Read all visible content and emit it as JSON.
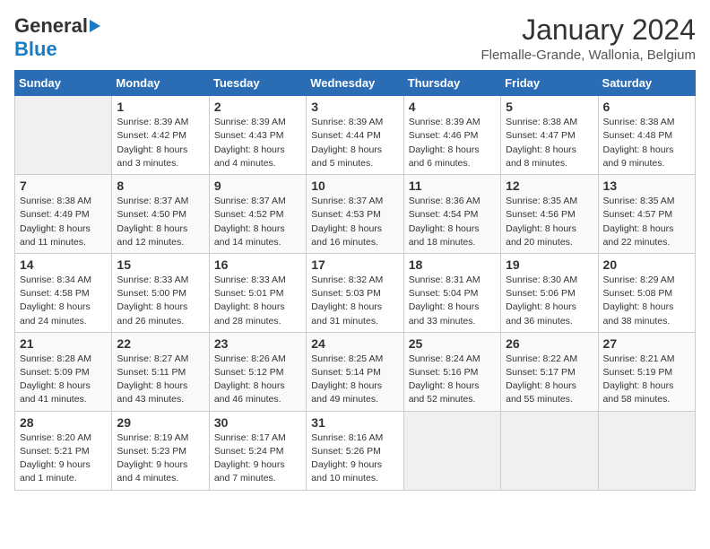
{
  "header": {
    "logo_general": "General",
    "logo_blue": "Blue",
    "month_title": "January 2024",
    "location": "Flemalle-Grande, Wallonia, Belgium"
  },
  "days_of_week": [
    "Sunday",
    "Monday",
    "Tuesday",
    "Wednesday",
    "Thursday",
    "Friday",
    "Saturday"
  ],
  "weeks": [
    [
      {
        "day": "",
        "sunrise": "",
        "sunset": "",
        "daylight": ""
      },
      {
        "day": "1",
        "sunrise": "Sunrise: 8:39 AM",
        "sunset": "Sunset: 4:42 PM",
        "daylight": "Daylight: 8 hours and 3 minutes."
      },
      {
        "day": "2",
        "sunrise": "Sunrise: 8:39 AM",
        "sunset": "Sunset: 4:43 PM",
        "daylight": "Daylight: 8 hours and 4 minutes."
      },
      {
        "day": "3",
        "sunrise": "Sunrise: 8:39 AM",
        "sunset": "Sunset: 4:44 PM",
        "daylight": "Daylight: 8 hours and 5 minutes."
      },
      {
        "day": "4",
        "sunrise": "Sunrise: 8:39 AM",
        "sunset": "Sunset: 4:46 PM",
        "daylight": "Daylight: 8 hours and 6 minutes."
      },
      {
        "day": "5",
        "sunrise": "Sunrise: 8:38 AM",
        "sunset": "Sunset: 4:47 PM",
        "daylight": "Daylight: 8 hours and 8 minutes."
      },
      {
        "day": "6",
        "sunrise": "Sunrise: 8:38 AM",
        "sunset": "Sunset: 4:48 PM",
        "daylight": "Daylight: 8 hours and 9 minutes."
      }
    ],
    [
      {
        "day": "7",
        "sunrise": "Sunrise: 8:38 AM",
        "sunset": "Sunset: 4:49 PM",
        "daylight": "Daylight: 8 hours and 11 minutes."
      },
      {
        "day": "8",
        "sunrise": "Sunrise: 8:37 AM",
        "sunset": "Sunset: 4:50 PM",
        "daylight": "Daylight: 8 hours and 12 minutes."
      },
      {
        "day": "9",
        "sunrise": "Sunrise: 8:37 AM",
        "sunset": "Sunset: 4:52 PM",
        "daylight": "Daylight: 8 hours and 14 minutes."
      },
      {
        "day": "10",
        "sunrise": "Sunrise: 8:37 AM",
        "sunset": "Sunset: 4:53 PM",
        "daylight": "Daylight: 8 hours and 16 minutes."
      },
      {
        "day": "11",
        "sunrise": "Sunrise: 8:36 AM",
        "sunset": "Sunset: 4:54 PM",
        "daylight": "Daylight: 8 hours and 18 minutes."
      },
      {
        "day": "12",
        "sunrise": "Sunrise: 8:35 AM",
        "sunset": "Sunset: 4:56 PM",
        "daylight": "Daylight: 8 hours and 20 minutes."
      },
      {
        "day": "13",
        "sunrise": "Sunrise: 8:35 AM",
        "sunset": "Sunset: 4:57 PM",
        "daylight": "Daylight: 8 hours and 22 minutes."
      }
    ],
    [
      {
        "day": "14",
        "sunrise": "Sunrise: 8:34 AM",
        "sunset": "Sunset: 4:58 PM",
        "daylight": "Daylight: 8 hours and 24 minutes."
      },
      {
        "day": "15",
        "sunrise": "Sunrise: 8:33 AM",
        "sunset": "Sunset: 5:00 PM",
        "daylight": "Daylight: 8 hours and 26 minutes."
      },
      {
        "day": "16",
        "sunrise": "Sunrise: 8:33 AM",
        "sunset": "Sunset: 5:01 PM",
        "daylight": "Daylight: 8 hours and 28 minutes."
      },
      {
        "day": "17",
        "sunrise": "Sunrise: 8:32 AM",
        "sunset": "Sunset: 5:03 PM",
        "daylight": "Daylight: 8 hours and 31 minutes."
      },
      {
        "day": "18",
        "sunrise": "Sunrise: 8:31 AM",
        "sunset": "Sunset: 5:04 PM",
        "daylight": "Daylight: 8 hours and 33 minutes."
      },
      {
        "day": "19",
        "sunrise": "Sunrise: 8:30 AM",
        "sunset": "Sunset: 5:06 PM",
        "daylight": "Daylight: 8 hours and 36 minutes."
      },
      {
        "day": "20",
        "sunrise": "Sunrise: 8:29 AM",
        "sunset": "Sunset: 5:08 PM",
        "daylight": "Daylight: 8 hours and 38 minutes."
      }
    ],
    [
      {
        "day": "21",
        "sunrise": "Sunrise: 8:28 AM",
        "sunset": "Sunset: 5:09 PM",
        "daylight": "Daylight: 8 hours and 41 minutes."
      },
      {
        "day": "22",
        "sunrise": "Sunrise: 8:27 AM",
        "sunset": "Sunset: 5:11 PM",
        "daylight": "Daylight: 8 hours and 43 minutes."
      },
      {
        "day": "23",
        "sunrise": "Sunrise: 8:26 AM",
        "sunset": "Sunset: 5:12 PM",
        "daylight": "Daylight: 8 hours and 46 minutes."
      },
      {
        "day": "24",
        "sunrise": "Sunrise: 8:25 AM",
        "sunset": "Sunset: 5:14 PM",
        "daylight": "Daylight: 8 hours and 49 minutes."
      },
      {
        "day": "25",
        "sunrise": "Sunrise: 8:24 AM",
        "sunset": "Sunset: 5:16 PM",
        "daylight": "Daylight: 8 hours and 52 minutes."
      },
      {
        "day": "26",
        "sunrise": "Sunrise: 8:22 AM",
        "sunset": "Sunset: 5:17 PM",
        "daylight": "Daylight: 8 hours and 55 minutes."
      },
      {
        "day": "27",
        "sunrise": "Sunrise: 8:21 AM",
        "sunset": "Sunset: 5:19 PM",
        "daylight": "Daylight: 8 hours and 58 minutes."
      }
    ],
    [
      {
        "day": "28",
        "sunrise": "Sunrise: 8:20 AM",
        "sunset": "Sunset: 5:21 PM",
        "daylight": "Daylight: 9 hours and 1 minute."
      },
      {
        "day": "29",
        "sunrise": "Sunrise: 8:19 AM",
        "sunset": "Sunset: 5:23 PM",
        "daylight": "Daylight: 9 hours and 4 minutes."
      },
      {
        "day": "30",
        "sunrise": "Sunrise: 8:17 AM",
        "sunset": "Sunset: 5:24 PM",
        "daylight": "Daylight: 9 hours and 7 minutes."
      },
      {
        "day": "31",
        "sunrise": "Sunrise: 8:16 AM",
        "sunset": "Sunset: 5:26 PM",
        "daylight": "Daylight: 9 hours and 10 minutes."
      },
      {
        "day": "",
        "sunrise": "",
        "sunset": "",
        "daylight": ""
      },
      {
        "day": "",
        "sunrise": "",
        "sunset": "",
        "daylight": ""
      },
      {
        "day": "",
        "sunrise": "",
        "sunset": "",
        "daylight": ""
      }
    ]
  ]
}
